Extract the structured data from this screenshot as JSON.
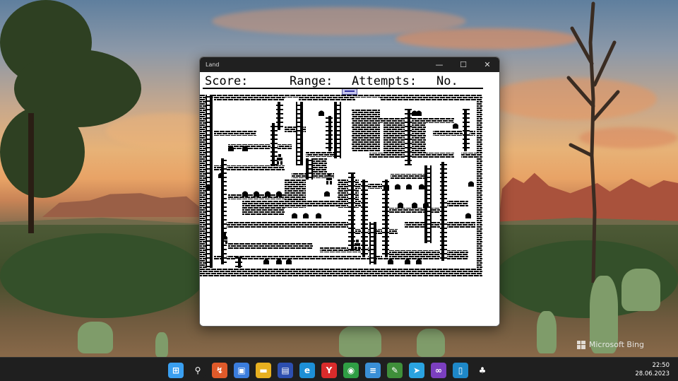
{
  "window": {
    "title": "Land",
    "controls": {
      "minimize": "—",
      "maximize": "☐",
      "close": "✕"
    }
  },
  "hud": {
    "score_label": "Score:",
    "range_label": "Range:",
    "attempts_label": "Attempts:",
    "number_label": "No."
  },
  "watermark": {
    "text": "Microsoft Bing"
  },
  "taskbar": {
    "time": "22:50",
    "date": "28.06.2023",
    "apps": [
      {
        "icon": "windows-start-icon",
        "glyph": "⊞",
        "color": "#3a9ff0"
      },
      {
        "icon": "search-icon",
        "glyph": "⚲",
        "color": "#1f1f1f"
      },
      {
        "icon": "remote-desktop-icon",
        "glyph": "↯",
        "color": "#e05a2a"
      },
      {
        "icon": "store-icon",
        "glyph": "▣",
        "color": "#3b7ddd"
      },
      {
        "icon": "file-explorer-icon",
        "glyph": "▬",
        "color": "#e8b020"
      },
      {
        "icon": "floppy-save-icon",
        "glyph": "▤",
        "color": "#2d4fb0"
      },
      {
        "icon": "edge-icon",
        "glyph": "e",
        "color": "#1d8fd6"
      },
      {
        "icon": "yandex-icon",
        "glyph": "Y",
        "color": "#d92b2b"
      },
      {
        "icon": "chrome-icon",
        "glyph": "◉",
        "color": "#2f9e44"
      },
      {
        "icon": "notepad-icon",
        "glyph": "≡",
        "color": "#3a8fd6"
      },
      {
        "icon": "image-editor-icon",
        "glyph": "✎",
        "color": "#3f8f3a"
      },
      {
        "icon": "telegram-icon",
        "glyph": "➤",
        "color": "#2aa3e0"
      },
      {
        "icon": "visual-studio-icon",
        "glyph": "∞",
        "color": "#7b3fbf"
      },
      {
        "icon": "phone-link-icon",
        "glyph": "▯",
        "color": "#1e88c8"
      },
      {
        "icon": "tree-app-icon",
        "glyph": "♣",
        "color": "#1f1f1f"
      }
    ]
  }
}
